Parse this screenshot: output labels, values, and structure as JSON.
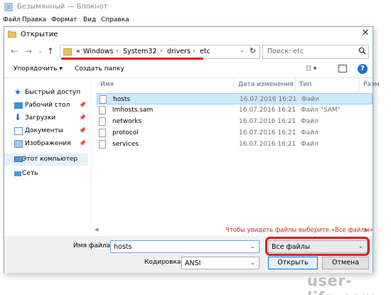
{
  "notepad": {
    "title": "Безымянный — Блокнот",
    "menu": [
      "Файл",
      "Правка",
      "Формат",
      "Вид",
      "Справка"
    ]
  },
  "dialog": {
    "title": "Открытие",
    "close": "✕",
    "breadcrumb": [
      "«",
      "Windows",
      "System32",
      "drivers",
      "etc"
    ],
    "search_placeholder": "Поиск: etc",
    "toolbar": {
      "organize": "Упорядочить ▾",
      "new_folder": "Создать папку"
    },
    "nav": [
      {
        "label": "Быстрый доступ",
        "icon": "star-icon"
      },
      {
        "label": "Рабочий стол",
        "icon": "desktop-icon"
      },
      {
        "label": "Загрузки",
        "icon": "download-icon"
      },
      {
        "label": "Документы",
        "icon": "documents-icon"
      },
      {
        "label": "Изображения",
        "icon": "pictures-icon"
      },
      {
        "label": "Этот компьютер",
        "icon": "computer-icon"
      },
      {
        "label": "Сеть",
        "icon": "network-icon"
      }
    ],
    "columns": [
      "Имя",
      "Дата изменения",
      "Тип",
      "Разм"
    ],
    "files": [
      {
        "name": "hosts",
        "date": "16.07.2016 16:21",
        "type": "Файл"
      },
      {
        "name": "lmhosts.sam",
        "date": "16.07.2016 16:21",
        "type": "Файл \"SAM\""
      },
      {
        "name": "networks",
        "date": "16.07.2016 16:21",
        "type": "Файл"
      },
      {
        "name": "protocol",
        "date": "16.07.2016 16:21",
        "type": "Файл"
      },
      {
        "name": "services",
        "date": "16.07.2016 16:21",
        "type": "Файл"
      }
    ],
    "hint": "Чтобы увидеть файлы выберите «Все файлы»",
    "filename_label": "Имя файла:",
    "filename_value": "hosts",
    "filetype_value": "Все файлы",
    "encoding_label": "Кодировка:",
    "encoding_value": "ANSI",
    "open_label": "Открыть",
    "cancel_label": "Отмена"
  },
  "watermark": "user-life.com",
  "colors": {
    "accent": "#0078d7",
    "highlight_red": "#d6201e",
    "selection": "#cce8ff"
  }
}
